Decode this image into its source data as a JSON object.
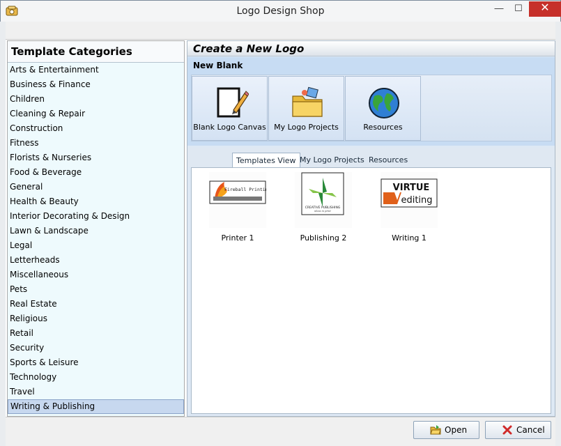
{
  "window": {
    "title": "Logo Design Shop",
    "minimize_glyph": "—",
    "maximize_glyph": "☐",
    "close_glyph": "✕",
    "close_color": "#c6302a"
  },
  "categories": {
    "header": "Template Categories",
    "items": [
      "Arts & Entertainment",
      "Business & Finance",
      "Children",
      "Cleaning & Repair",
      "Construction",
      "Fitness",
      "Florists & Nurseries",
      "Food & Beverage",
      "General",
      "Health & Beauty",
      "Interior Decorating & Design",
      "Lawn & Landscape",
      "Legal",
      "Letterheads",
      "Miscellaneous",
      "Pets",
      "Real Estate",
      "Religious",
      "Retail",
      "Security",
      "Sports & Leisure",
      "Technology",
      "Travel",
      "Writing & Publishing"
    ],
    "selected": "Writing & Publishing"
  },
  "create": {
    "header": "Create a New Logo",
    "section_label": "New Blank",
    "tiles": [
      {
        "label": "Blank Logo Canvas",
        "icon": "pencil-document-icon"
      },
      {
        "label": "My Logo Projects",
        "icon": "folder-icon"
      },
      {
        "label": "Resources",
        "icon": "globe-icon"
      }
    ]
  },
  "tabs": [
    {
      "label": "Templates View",
      "active": true
    },
    {
      "label": "My Logo Projects",
      "active": false
    },
    {
      "label": "Resources",
      "active": false
    }
  ],
  "templates": [
    {
      "label": "Printer 1",
      "logo_text": "Fireball Printing"
    },
    {
      "label": "Publishing 2",
      "logo_text": "CREATIVE PUBLISHING",
      "logo_subtext": "ideas in print"
    },
    {
      "label": "Writing 1",
      "logo_text_top": "VIRTUE",
      "logo_text_bottom": "editing"
    }
  ],
  "buttons": {
    "open": "Open",
    "cancel": "Cancel"
  },
  "colors": {
    "selection": "#c7d8ef",
    "panel_blue": "#c7dcf3",
    "list_bg": "#eefafd"
  }
}
